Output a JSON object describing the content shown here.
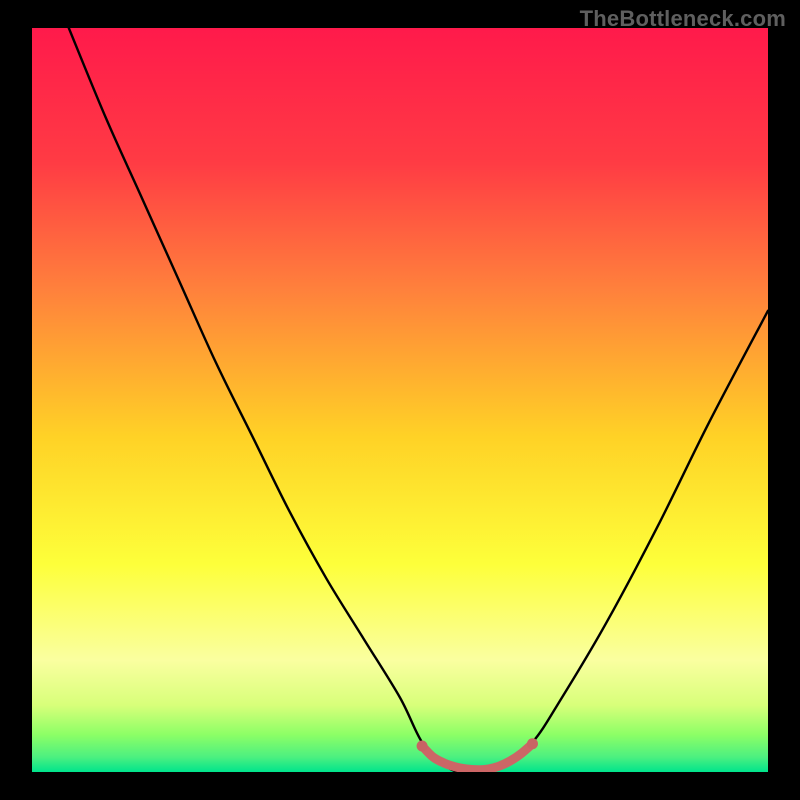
{
  "watermark": "TheBottleneck.com",
  "chart_data": {
    "type": "line",
    "title": "",
    "xlabel": "",
    "ylabel": "",
    "xlim": [
      0,
      100
    ],
    "ylim": [
      0,
      100
    ],
    "grid": false,
    "legend": false,
    "background_gradient": [
      "#ff1a4b",
      "#ff6a3d",
      "#ffd633",
      "#f7ff47",
      "#a6ff5c",
      "#00e676"
    ],
    "series": [
      {
        "name": "bottleneck-curve",
        "color": "#000000",
        "x": [
          5,
          10,
          15,
          20,
          25,
          30,
          35,
          40,
          45,
          50,
          53,
          56,
          58,
          61,
          64,
          68,
          72,
          78,
          85,
          92,
          100
        ],
        "values": [
          100,
          88,
          77,
          66,
          55,
          45,
          35,
          26,
          18,
          10,
          4,
          1,
          0,
          0,
          1,
          4,
          10,
          20,
          33,
          47,
          62
        ]
      },
      {
        "name": "optimal-band",
        "color": "#cc6666",
        "x": [
          53,
          54.5,
          56,
          57.5,
          59,
          60.5,
          62,
          63.5,
          65,
          66.5,
          68
        ],
        "values": [
          3.5,
          2.0,
          1.2,
          0.7,
          0.4,
          0.3,
          0.4,
          0.8,
          1.5,
          2.5,
          3.8
        ]
      }
    ]
  }
}
